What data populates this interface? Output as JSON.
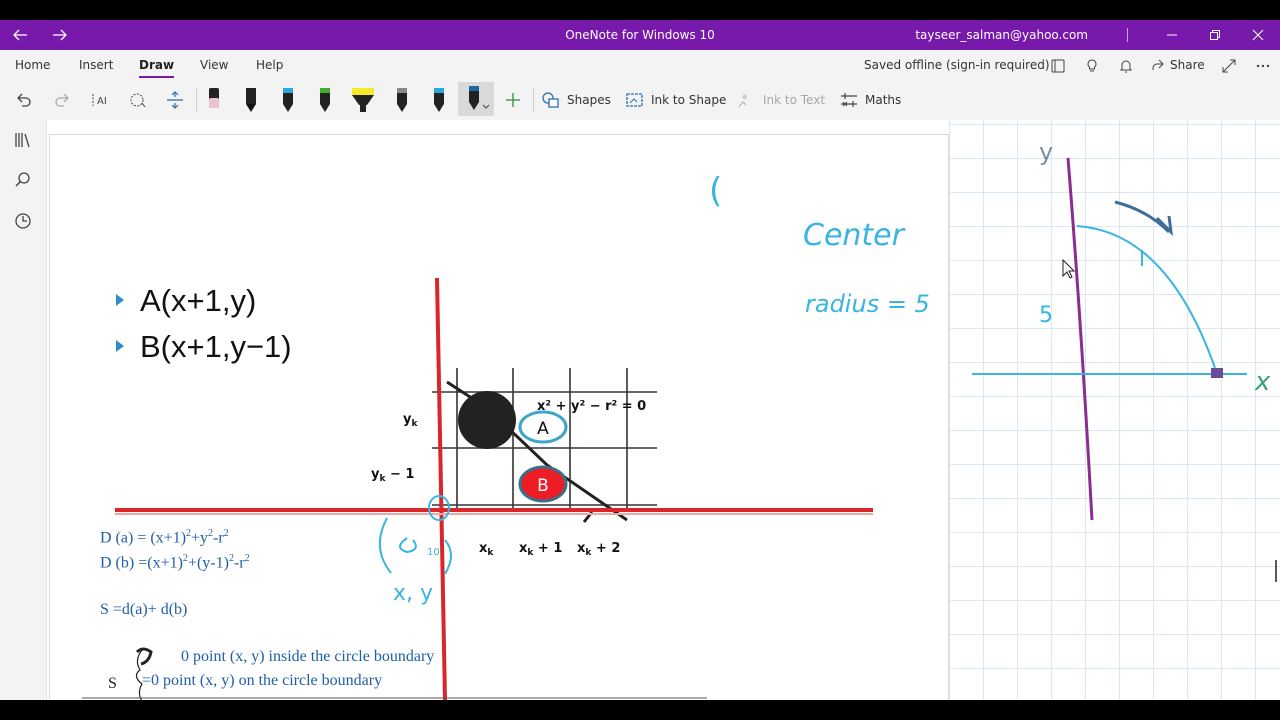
{
  "app": {
    "title": "OneNote for Windows 10",
    "account": "tayseer_salman@yahoo.com"
  },
  "ribbon": {
    "tabs": [
      {
        "label": "Home"
      },
      {
        "label": "Insert"
      },
      {
        "label": "Draw"
      },
      {
        "label": "View"
      },
      {
        "label": "Help"
      }
    ],
    "active_tab": "Draw",
    "status": "Saved offline (sign-in required)",
    "share_label": "Share"
  },
  "toolbar": {
    "shapes_label": "Shapes",
    "ink_to_shape_label": "Ink to Shape",
    "ink_to_text_label": "Ink to Text",
    "maths_label": "Maths",
    "pens": [
      {
        "color": "#e9c4cf"
      },
      {
        "color": "#111111"
      },
      {
        "color": "#29a8e0"
      },
      {
        "color": "#3fae2a"
      },
      {
        "color": "#f4ea2a"
      },
      {
        "color": "#8a8a8a"
      },
      {
        "color": "#29a8e0"
      },
      {
        "color": "#1b6aa5"
      }
    ]
  },
  "slide": {
    "bullets": [
      {
        "text": "A(x+1,y)"
      },
      {
        "text": "B(x+1,y−1)"
      }
    ],
    "formulas": {
      "da_prefix": "D (a) = (x+1)",
      "da_mid": "+y",
      "da_mid2": "-r",
      "db_prefix": "D (b) =(x+1)",
      "db_mid": "+(y-1)",
      "db_mid2": "-r",
      "exp": "2",
      "s_line": "S =d(a)+ d(b)",
      "s_label": "S",
      "case1": "0    point (x, y) inside the circle boundary",
      "case2": "=0   point (x, y) on the circle boundary"
    },
    "figure": {
      "equation": "x² + y² − r² = 0",
      "label_a": "A",
      "label_b": "B",
      "yk": "y",
      "yk_sub": "k",
      "yk_minus": "y",
      "yk_minus_sub": "k",
      "yk_minus_suffix": " − 1",
      "xk": "x",
      "xk_sub": "k",
      "xk1": "x",
      "xk1_sub": "k",
      "xk1_suffix": " + 1",
      "xk2": "x",
      "xk2_sub": "k",
      "xk2_suffix": " + 2"
    }
  },
  "ink": {
    "center_word": "Center",
    "radius_word": "radius = 5",
    "xy_word": "x, y",
    "five": "5",
    "y_axis": "y",
    "x_axis": "x",
    "paren": "(",
    "ten": "10"
  },
  "colors": {
    "title_bar": "#7719aa",
    "ink_blue": "#39b5e0",
    "ink_purple": "#8b2d8e",
    "red_axis": "#d9262b",
    "b_fill": "#ee1c24"
  }
}
